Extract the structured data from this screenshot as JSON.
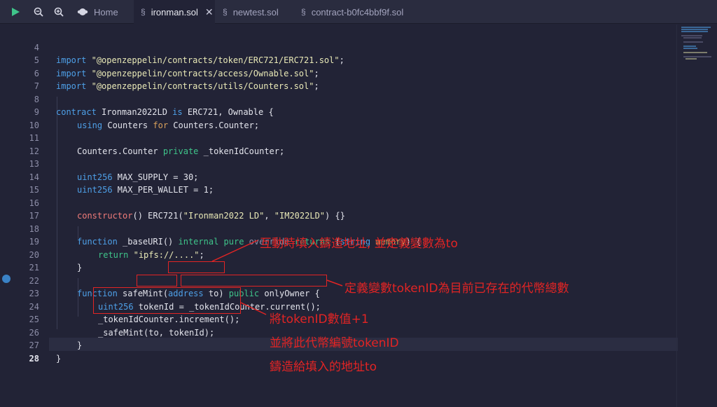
{
  "toolbar": {
    "run_icon": "play-icon",
    "zoom_out_icon": "zoom-out-icon",
    "zoom_in_icon": "zoom-in-icon"
  },
  "tabs": [
    {
      "label": "Home",
      "icon": "home-icon"
    },
    {
      "label": "ironman.sol",
      "icon": "solidity-file-icon",
      "active": true
    },
    {
      "label": "newtest.sol",
      "icon": "solidity-file-icon"
    },
    {
      "label": "contract-b0fc4bbf9f.sol",
      "icon": "solidity-file-icon"
    }
  ],
  "close_glyph": "✕",
  "line_numbers": [
    "4",
    "5",
    "6",
    "7",
    "8",
    "9",
    "10",
    "11",
    "12",
    "13",
    "14",
    "15",
    "16",
    "17",
    "18",
    "19",
    "20",
    "21",
    "22",
    "23",
    "24",
    "25",
    "26",
    "27",
    "28"
  ],
  "code": {
    "l4": {
      "kw": "import",
      "str": "\"@openzeppelin/contracts/token/ERC721/ERC721.sol\"",
      "end": ";"
    },
    "l5": {
      "kw": "import",
      "str": "\"@openzeppelin/contracts/access/Ownable.sol\"",
      "end": ";"
    },
    "l6": {
      "kw": "import",
      "str": "\"@openzeppelin/contracts/utils/Counters.sol\"",
      "end": ";"
    },
    "l8": {
      "kw": "contract",
      "name": " Ironman2022LD ",
      "is": "is",
      "rest": " ERC721, Ownable {"
    },
    "l9": {
      "kw": "using",
      "a": " Counters ",
      "for": "for",
      "b": " Counters.Counter;"
    },
    "l11": {
      "a": "Counters.Counter ",
      "vis": "private",
      "b": " _tokenIdCounter;"
    },
    "l13": {
      "ty": "uint256",
      "rest": " MAX_SUPPLY = 30;"
    },
    "l14": {
      "ty": "uint256",
      "rest": " MAX_PER_WALLET = 1;"
    },
    "l16": {
      "fn": "constructor",
      "a": "() ERC721(",
      "s1": "\"Ironman2022 LD\"",
      "c": ", ",
      "s2": "\"IM2022LD\"",
      "b": ") {}"
    },
    "l18": {
      "kw": "function",
      "a": " _baseURI() ",
      "internal": "internal",
      "pure": " pure ",
      "override": "override",
      "returns": " returns ",
      "b": "(",
      "string": "string",
      "memory": " memory",
      "c": ") {"
    },
    "l19": {
      "kw": "return",
      "str": "\"ipfs://....\"",
      "end": ";"
    },
    "l20": {
      "text": "}"
    },
    "l22": {
      "kw": "function",
      "a": " safeMint(",
      "addr": "address",
      "to": " to",
      "b": ") ",
      "pub": "public",
      "c": " onlyOwner {"
    },
    "l23": {
      "ty": "uint256",
      "a": " tokenId",
      "b": " = _tokenIdCounter.current();"
    },
    "l24": {
      "text": "_tokenIdCounter.increment();"
    },
    "l25": {
      "text": "_safeMint(to, tokenId);"
    },
    "l26": {
      "text": "}"
    },
    "l27": {
      "text": "}"
    }
  },
  "annotations": {
    "a1": "互動時填入鑄造地址, 並定義變數為to",
    "a2": "定義變數tokenID為目前已存在的代幣總數",
    "a3_l1": "將tokenID數值+1",
    "a3_l2": "並將此代幣編號tokenID",
    "a3_l3": "鑄造給填入的地址to"
  },
  "colors": {
    "background": "#222336",
    "keyword": "#4ea0e8",
    "string": "#e9e9b7",
    "annotation": "#e22424"
  }
}
